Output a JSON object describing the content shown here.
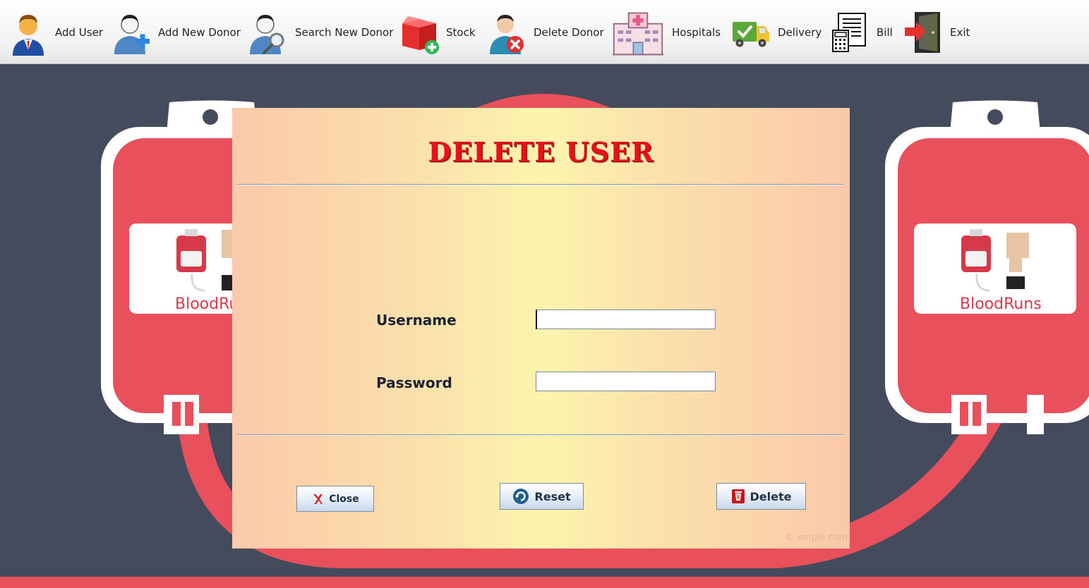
{
  "toolbar": {
    "items": [
      {
        "label": "Add User",
        "icon": "user-icon"
      },
      {
        "label": "Add New Donor",
        "icon": "add-donor-icon"
      },
      {
        "label": "Search New Donor",
        "icon": "search-donor-icon"
      },
      {
        "label": "Stock",
        "icon": "stock-icon"
      },
      {
        "label": "Delete Donor",
        "icon": "delete-donor-icon"
      },
      {
        "label": "Hospitals",
        "icon": "hospital-icon"
      },
      {
        "label": "Delivery",
        "icon": "delivery-truck-icon"
      },
      {
        "label": "Bill",
        "icon": "bill-icon"
      },
      {
        "label": "Exit",
        "icon": "exit-door-icon"
      }
    ]
  },
  "background": {
    "brand_text_left": "BloodRu",
    "brand_text_right": "BloodRuns"
  },
  "dialog": {
    "title": "DELETE USER",
    "username_label": "Username",
    "password_label": "Password",
    "username_value": "",
    "password_value": "",
    "close_label": "Close",
    "reset_label": "Reset",
    "delete_label": "Delete",
    "watermark": "© xmple.com"
  },
  "colors": {
    "title_red": "#e8101a",
    "background_slate": "#434b5c",
    "bag_red": "#e8505b"
  }
}
